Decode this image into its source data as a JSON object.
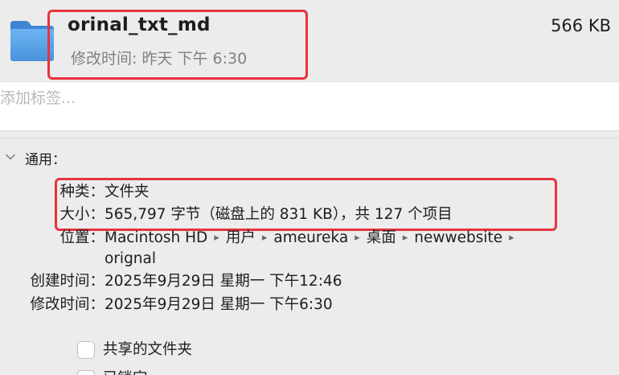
{
  "header": {
    "name": "orinal_txt_md",
    "modified_label": "修改时间",
    "modified_value": "昨天 下午 6:30",
    "size": "566 KB"
  },
  "tags": {
    "placeholder": "添加标签..."
  },
  "general": {
    "title": "通用：",
    "kind": {
      "label": "种类：",
      "value": "文件夹"
    },
    "size": {
      "label": "大小：",
      "value": "565,797 字节（磁盘上的 831 KB），共 127 个项目"
    },
    "where": {
      "label": "位置：",
      "path": [
        "Macintosh HD",
        "用户",
        "ameureka",
        "桌面",
        "newwebsite"
      ],
      "path_last": "orignal"
    },
    "created": {
      "label": "创建时间：",
      "value": "2025年9月29日 星期一 下午12:46"
    },
    "modified": {
      "label": "修改时间：",
      "value": "2025年9月29日 星期一 下午6:30"
    },
    "checkboxes": [
      {
        "label": "共享的文件夹",
        "checked": false
      },
      {
        "label": "已锁定",
        "checked": false
      }
    ]
  },
  "icons": {
    "folder": "folder-icon",
    "chevron": "chevron-down-icon",
    "path_separator": "triangle-right-icon"
  },
  "colors": {
    "folder": "#5aa3e8",
    "highlight_box": "#e8333f",
    "background": "#ececec"
  }
}
